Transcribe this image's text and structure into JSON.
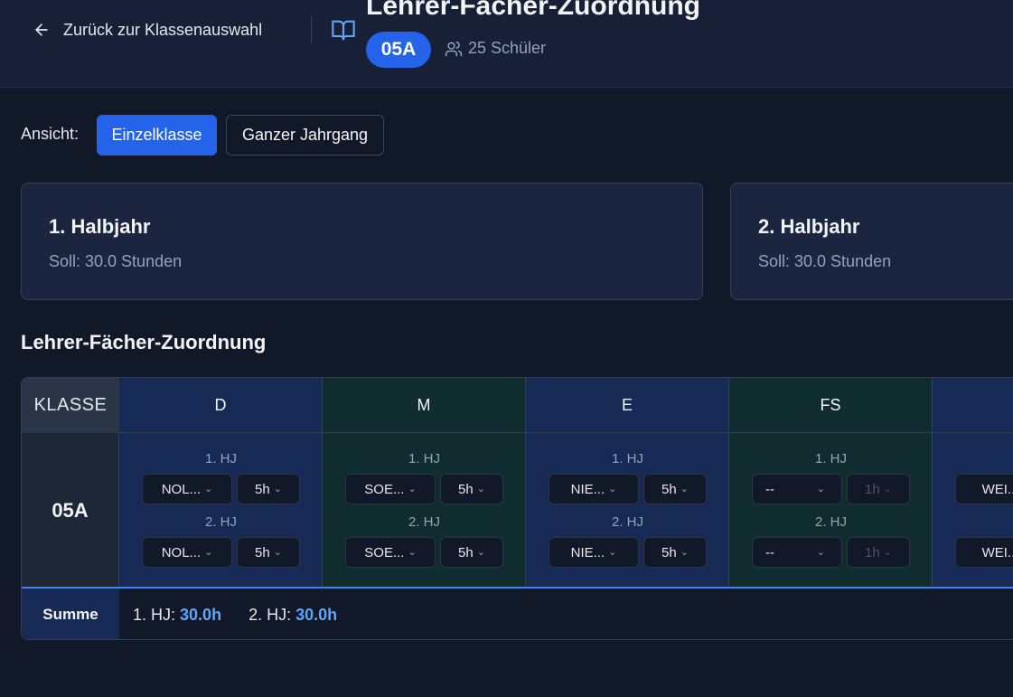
{
  "header": {
    "back_label": "Zurück zur Klassenauswahl",
    "title": "Lehrer-Fächer-Zuordnung",
    "class_badge": "05A",
    "students": "25 Schüler"
  },
  "view": {
    "label": "Ansicht:",
    "options": [
      "Einzelklasse",
      "Ganzer Jahrgang"
    ],
    "selected": "Einzelklasse"
  },
  "halfyears": [
    {
      "title": "1. Halbjahr",
      "soll": "Soll: 30.0 Stunden"
    },
    {
      "title": "2. Halbjahr",
      "soll": "Soll: 30.0 Stunden"
    }
  ],
  "section_title": "Lehrer-Fächer-Zuordnung",
  "table": {
    "klasse_header": "KLASSE",
    "row_label": "05A",
    "hj1_label": "1. HJ",
    "hj2_label": "2. HJ",
    "subjects": [
      {
        "name": "D",
        "hj1_teacher": "NOL...",
        "hj1_hours": "5h",
        "hj2_teacher": "NOL...",
        "hj2_hours": "5h"
      },
      {
        "name": "M",
        "hj1_teacher": "SOE...",
        "hj1_hours": "5h",
        "hj2_teacher": "SOE...",
        "hj2_hours": "5h"
      },
      {
        "name": "E",
        "hj1_teacher": "NIE...",
        "hj1_hours": "5h",
        "hj2_teacher": "NIE...",
        "hj2_hours": "5h"
      },
      {
        "name": "FS",
        "hj1_teacher": "--",
        "hj1_hours": "1h",
        "hj2_teacher": "--",
        "hj2_hours": "1h"
      },
      {
        "name": "",
        "hj1_teacher": "WEI...",
        "hj1_hours": "",
        "hj2_teacher": "WEI...",
        "hj2_hours": ""
      }
    ],
    "sum": {
      "label": "Summe",
      "hj1_prefix": "1. HJ:",
      "hj1_value": "30.0h",
      "hj2_prefix": "2. HJ:",
      "hj2_value": "30.0h"
    }
  },
  "colors": {
    "accent": "#2563eb",
    "highlight": "#60a5fa",
    "subject_blue": "#172a56",
    "subject_green": "#0f2d2e"
  }
}
